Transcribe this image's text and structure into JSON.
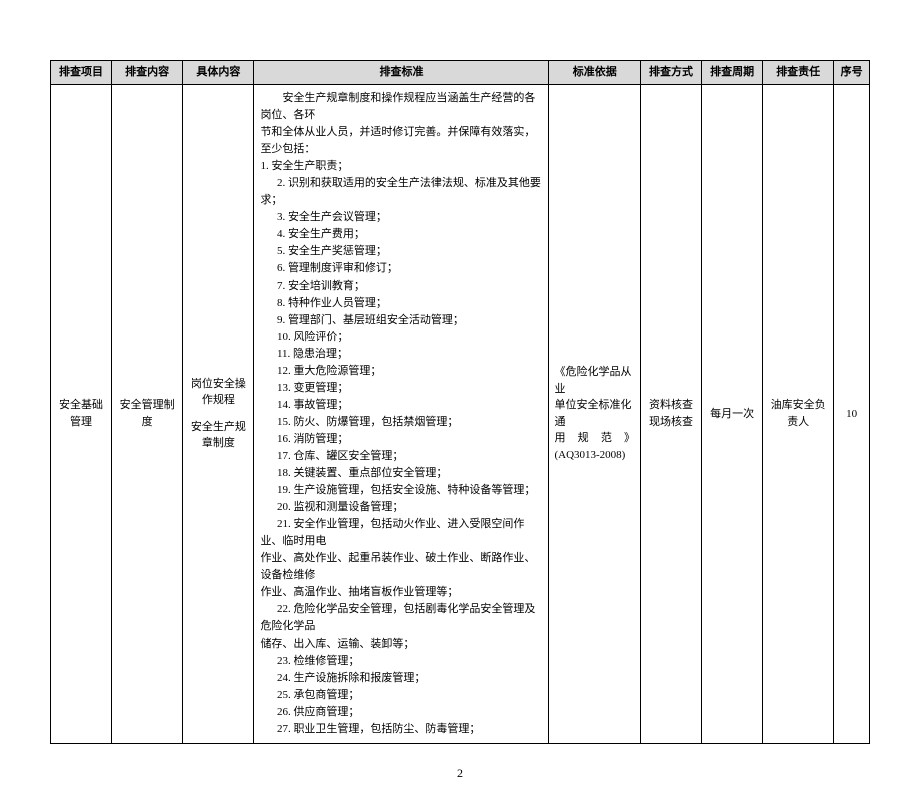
{
  "headers": {
    "c1": "排查项目",
    "c2": "排查内容",
    "c3": "具体内容",
    "c4": "排查标准",
    "c5": "标准依据",
    "c6": "排查方式",
    "c7": "排查周期",
    "c8": "排查责任",
    "c9": "序号"
  },
  "row": {
    "item": "安全基础管理",
    "content": "安全管理制度",
    "detail_line1": "岗位安全操作规程",
    "detail_line2": "安全生产规章制度",
    "standard_intro1": "安全生产规章制度和操作规程应当涵盖生产经营的各岗位、各环",
    "standard_intro2": "节和全体从业人员，并适时修订完善。并保障有效落实，至少包括：",
    "items": {
      "s1": "1. 安全生产职责；",
      "s2": "2. 识别和获取适用的安全生产法律法规、标准及其他要求；",
      "s3": "3. 安全生产会议管理；",
      "s4": "4. 安全生产费用；",
      "s5": "5. 安全生产奖惩管理；",
      "s6": "6. 管理制度评审和修订；",
      "s7": "7. 安全培训教育；",
      "s8": "8. 特种作业人员管理；",
      "s9": "9. 管理部门、基层班组安全活动管理；",
      "s10": "10. 风险评价；",
      "s11": "11. 隐患治理；",
      "s12": "12. 重大危险源管理；",
      "s13": "13. 变更管理；",
      "s14": "14. 事故管理；",
      "s15": "15. 防火、防爆管理，包括禁烟管理；",
      "s16": "16. 消防管理；",
      "s17": "17. 仓库、罐区安全管理；",
      "s18": "18. 关键装置、重点部位安全管理；",
      "s19": "19. 生产设施管理，包括安全设施、特种设备等管理；",
      "s20": "20. 监视和测量设备管理；",
      "s21a": "21. 安全作业管理，包括动火作业、进入受限空间作业、临时用电",
      "s21b": "作业、高处作业、起重吊装作业、破土作业、断路作业、设备检维修",
      "s21c": "作业、高温作业、抽堵盲板作业管理等；",
      "s22a": "22. 危险化学品安全管理，包括剧毒化学品安全管理及危险化学品",
      "s22b": "储存、出入库、运输、装卸等；",
      "s23": "23. 检维修管理；",
      "s24": "24. 生产设施拆除和报废管理；",
      "s25": "25. 承包商管理；",
      "s26": "26. 供应商管理；",
      "s27": "27. 职业卫生管理，包括防尘、防毒管理；"
    },
    "basis_l1": "《危险化学品从业",
    "basis_l2": "单位安全标准化通",
    "basis_l3": "用 规 范 》",
    "basis_l4": "(AQ3013-2008)",
    "method_l1": "资料核查",
    "method_l2": "现场核查",
    "cycle": "每月一次",
    "responsibility_l1": "油库安全负",
    "responsibility_l2": "责人",
    "seq": "10"
  },
  "page_number": "2"
}
